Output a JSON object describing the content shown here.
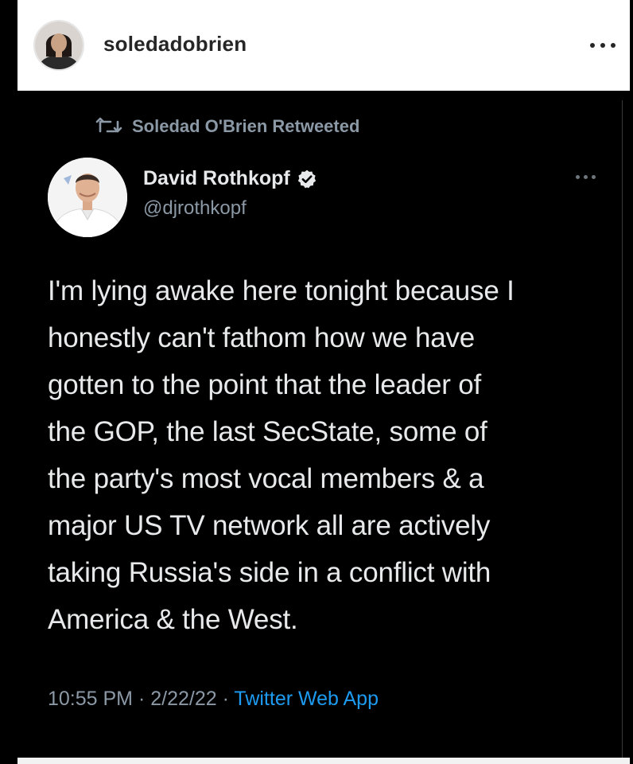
{
  "instagram_header": {
    "username": "soledadobrien",
    "more_icon": "more-horizontal-icon"
  },
  "tweet": {
    "retweet_icon": "retweet-icon",
    "retweeted_by": "Soledad O'Brien Retweeted",
    "author": {
      "name": "David Rothkopf",
      "handle": "@djrothkopf",
      "verified": true,
      "verified_icon": "verified-badge-icon"
    },
    "text_lines": [
      "I'm lying awake here tonight because I",
      "honestly can't fathom how we have",
      "gotten to the point that the leader of",
      "the GOP, the last SecState, some of",
      "the party's most vocal members & a",
      "major US TV network all are actively",
      "taking Russia's side in a conflict with",
      "America & the West."
    ],
    "time": "10:55 PM",
    "separator": " · ",
    "date": "2/22/22",
    "source_app": "Twitter Web App"
  },
  "colors": {
    "background": "#000000",
    "header_bg": "#ffffff",
    "text_primary": "#e7e9ea",
    "text_secondary": "#8b98a5",
    "link_blue": "#1d9bf0",
    "verified_badge": "#e7e9ea"
  }
}
